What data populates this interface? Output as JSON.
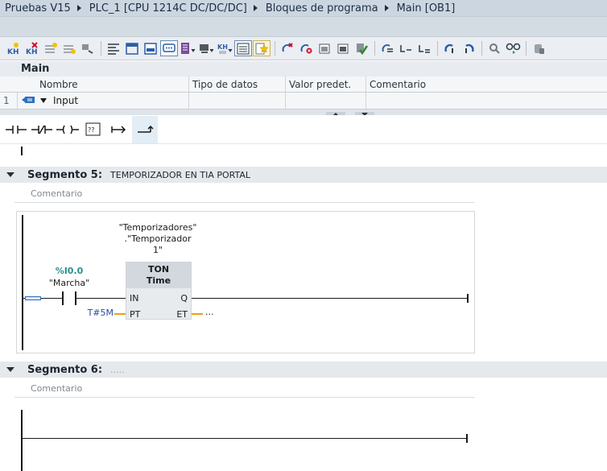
{
  "breadcrumb": {
    "project": "Pruebas V15",
    "device": "PLC_1 [CPU 1214C DC/DC/DC]",
    "folder": "Bloques de programa",
    "block": "Main [OB1]"
  },
  "interface": {
    "block_name": "Main",
    "columns": [
      "Nombre",
      "Tipo de datos",
      "Valor predet.",
      "Comentario"
    ],
    "rows": [
      {
        "index": "1",
        "name": "Input",
        "type": "",
        "default": "",
        "comment": ""
      }
    ]
  },
  "networks": [
    {
      "label": "Segmento 5:",
      "title": "TEMPORIZADOR EN TIA PORTAL",
      "comment_placeholder": "Comentario",
      "contact_address": "%I0.0",
      "contact_symbol": "\"Marcha\"",
      "timer_instance_line1": "\"Temporizadores\"",
      "timer_instance_line2": ".\"Temporizador",
      "timer_instance_line3": "1\"",
      "timer_type": "TON",
      "timer_datatype": "Time",
      "pin_in": "IN",
      "pin_pt": "PT",
      "pin_q": "Q",
      "pin_et": "ET",
      "pt_value": "T#5M",
      "et_value": "..."
    },
    {
      "label": "Segmento 6:",
      "title": ".....",
      "comment_placeholder": "Comentario"
    }
  ],
  "colors": {
    "address_green": "#2b8f8f",
    "param_blue": "#1f4f9c",
    "wire_yellow": "#e8a317"
  }
}
